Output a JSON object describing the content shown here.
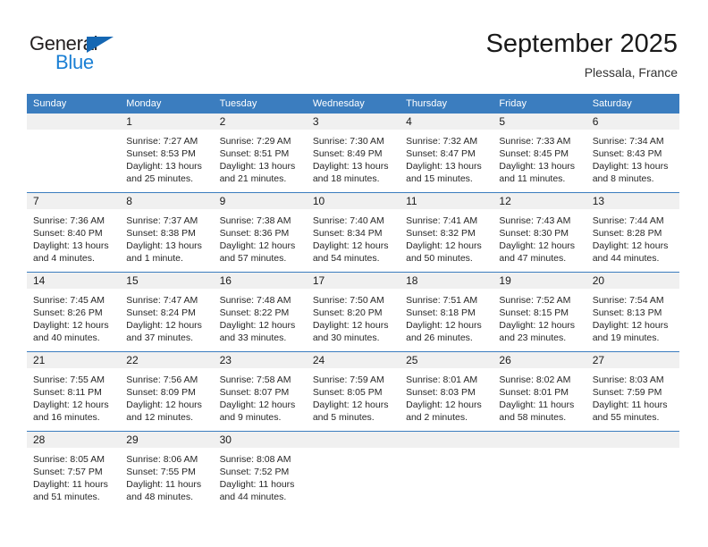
{
  "brand": {
    "name_part1": "General",
    "name_part2": "Blue",
    "accent_color": "#1567b3",
    "blue_text_color": "#1a7fd4"
  },
  "header": {
    "title": "September 2025",
    "subtitle": "Plessala, France"
  },
  "theme": {
    "header_row_color": "#3b7dbf",
    "daynum_band_color": "#f0f0f0",
    "separator_color": "#3b7dbf"
  },
  "weekdays": [
    "Sunday",
    "Monday",
    "Tuesday",
    "Wednesday",
    "Thursday",
    "Friday",
    "Saturday"
  ],
  "weeks": [
    [
      {
        "day": "",
        "sunrise": "",
        "sunset": "",
        "daylight1": "",
        "daylight2": ""
      },
      {
        "day": "1",
        "sunrise": "Sunrise: 7:27 AM",
        "sunset": "Sunset: 8:53 PM",
        "daylight1": "Daylight: 13 hours",
        "daylight2": "and 25 minutes."
      },
      {
        "day": "2",
        "sunrise": "Sunrise: 7:29 AM",
        "sunset": "Sunset: 8:51 PM",
        "daylight1": "Daylight: 13 hours",
        "daylight2": "and 21 minutes."
      },
      {
        "day": "3",
        "sunrise": "Sunrise: 7:30 AM",
        "sunset": "Sunset: 8:49 PM",
        "daylight1": "Daylight: 13 hours",
        "daylight2": "and 18 minutes."
      },
      {
        "day": "4",
        "sunrise": "Sunrise: 7:32 AM",
        "sunset": "Sunset: 8:47 PM",
        "daylight1": "Daylight: 13 hours",
        "daylight2": "and 15 minutes."
      },
      {
        "day": "5",
        "sunrise": "Sunrise: 7:33 AM",
        "sunset": "Sunset: 8:45 PM",
        "daylight1": "Daylight: 13 hours",
        "daylight2": "and 11 minutes."
      },
      {
        "day": "6",
        "sunrise": "Sunrise: 7:34 AM",
        "sunset": "Sunset: 8:43 PM",
        "daylight1": "Daylight: 13 hours",
        "daylight2": "and 8 minutes."
      }
    ],
    [
      {
        "day": "7",
        "sunrise": "Sunrise: 7:36 AM",
        "sunset": "Sunset: 8:40 PM",
        "daylight1": "Daylight: 13 hours",
        "daylight2": "and 4 minutes."
      },
      {
        "day": "8",
        "sunrise": "Sunrise: 7:37 AM",
        "sunset": "Sunset: 8:38 PM",
        "daylight1": "Daylight: 13 hours",
        "daylight2": "and 1 minute."
      },
      {
        "day": "9",
        "sunrise": "Sunrise: 7:38 AM",
        "sunset": "Sunset: 8:36 PM",
        "daylight1": "Daylight: 12 hours",
        "daylight2": "and 57 minutes."
      },
      {
        "day": "10",
        "sunrise": "Sunrise: 7:40 AM",
        "sunset": "Sunset: 8:34 PM",
        "daylight1": "Daylight: 12 hours",
        "daylight2": "and 54 minutes."
      },
      {
        "day": "11",
        "sunrise": "Sunrise: 7:41 AM",
        "sunset": "Sunset: 8:32 PM",
        "daylight1": "Daylight: 12 hours",
        "daylight2": "and 50 minutes."
      },
      {
        "day": "12",
        "sunrise": "Sunrise: 7:43 AM",
        "sunset": "Sunset: 8:30 PM",
        "daylight1": "Daylight: 12 hours",
        "daylight2": "and 47 minutes."
      },
      {
        "day": "13",
        "sunrise": "Sunrise: 7:44 AM",
        "sunset": "Sunset: 8:28 PM",
        "daylight1": "Daylight: 12 hours",
        "daylight2": "and 44 minutes."
      }
    ],
    [
      {
        "day": "14",
        "sunrise": "Sunrise: 7:45 AM",
        "sunset": "Sunset: 8:26 PM",
        "daylight1": "Daylight: 12 hours",
        "daylight2": "and 40 minutes."
      },
      {
        "day": "15",
        "sunrise": "Sunrise: 7:47 AM",
        "sunset": "Sunset: 8:24 PM",
        "daylight1": "Daylight: 12 hours",
        "daylight2": "and 37 minutes."
      },
      {
        "day": "16",
        "sunrise": "Sunrise: 7:48 AM",
        "sunset": "Sunset: 8:22 PM",
        "daylight1": "Daylight: 12 hours",
        "daylight2": "and 33 minutes."
      },
      {
        "day": "17",
        "sunrise": "Sunrise: 7:50 AM",
        "sunset": "Sunset: 8:20 PM",
        "daylight1": "Daylight: 12 hours",
        "daylight2": "and 30 minutes."
      },
      {
        "day": "18",
        "sunrise": "Sunrise: 7:51 AM",
        "sunset": "Sunset: 8:18 PM",
        "daylight1": "Daylight: 12 hours",
        "daylight2": "and 26 minutes."
      },
      {
        "day": "19",
        "sunrise": "Sunrise: 7:52 AM",
        "sunset": "Sunset: 8:15 PM",
        "daylight1": "Daylight: 12 hours",
        "daylight2": "and 23 minutes."
      },
      {
        "day": "20",
        "sunrise": "Sunrise: 7:54 AM",
        "sunset": "Sunset: 8:13 PM",
        "daylight1": "Daylight: 12 hours",
        "daylight2": "and 19 minutes."
      }
    ],
    [
      {
        "day": "21",
        "sunrise": "Sunrise: 7:55 AM",
        "sunset": "Sunset: 8:11 PM",
        "daylight1": "Daylight: 12 hours",
        "daylight2": "and 16 minutes."
      },
      {
        "day": "22",
        "sunrise": "Sunrise: 7:56 AM",
        "sunset": "Sunset: 8:09 PM",
        "daylight1": "Daylight: 12 hours",
        "daylight2": "and 12 minutes."
      },
      {
        "day": "23",
        "sunrise": "Sunrise: 7:58 AM",
        "sunset": "Sunset: 8:07 PM",
        "daylight1": "Daylight: 12 hours",
        "daylight2": "and 9 minutes."
      },
      {
        "day": "24",
        "sunrise": "Sunrise: 7:59 AM",
        "sunset": "Sunset: 8:05 PM",
        "daylight1": "Daylight: 12 hours",
        "daylight2": "and 5 minutes."
      },
      {
        "day": "25",
        "sunrise": "Sunrise: 8:01 AM",
        "sunset": "Sunset: 8:03 PM",
        "daylight1": "Daylight: 12 hours",
        "daylight2": "and 2 minutes."
      },
      {
        "day": "26",
        "sunrise": "Sunrise: 8:02 AM",
        "sunset": "Sunset: 8:01 PM",
        "daylight1": "Daylight: 11 hours",
        "daylight2": "and 58 minutes."
      },
      {
        "day": "27",
        "sunrise": "Sunrise: 8:03 AM",
        "sunset": "Sunset: 7:59 PM",
        "daylight1": "Daylight: 11 hours",
        "daylight2": "and 55 minutes."
      }
    ],
    [
      {
        "day": "28",
        "sunrise": "Sunrise: 8:05 AM",
        "sunset": "Sunset: 7:57 PM",
        "daylight1": "Daylight: 11 hours",
        "daylight2": "and 51 minutes."
      },
      {
        "day": "29",
        "sunrise": "Sunrise: 8:06 AM",
        "sunset": "Sunset: 7:55 PM",
        "daylight1": "Daylight: 11 hours",
        "daylight2": "and 48 minutes."
      },
      {
        "day": "30",
        "sunrise": "Sunrise: 8:08 AM",
        "sunset": "Sunset: 7:52 PM",
        "daylight1": "Daylight: 11 hours",
        "daylight2": "and 44 minutes."
      },
      {
        "day": "",
        "sunrise": "",
        "sunset": "",
        "daylight1": "",
        "daylight2": ""
      },
      {
        "day": "",
        "sunrise": "",
        "sunset": "",
        "daylight1": "",
        "daylight2": ""
      },
      {
        "day": "",
        "sunrise": "",
        "sunset": "",
        "daylight1": "",
        "daylight2": ""
      },
      {
        "day": "",
        "sunrise": "",
        "sunset": "",
        "daylight1": "",
        "daylight2": ""
      }
    ]
  ]
}
